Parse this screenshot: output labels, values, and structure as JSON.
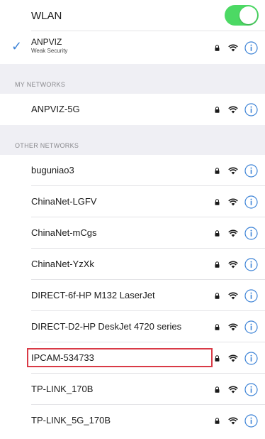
{
  "wlan": {
    "label": "WLAN",
    "toggle_on": true,
    "toggle_color": "#4cd964"
  },
  "current_network": {
    "name": "ANPVIZ",
    "security_note": "Weak Security",
    "connected": true,
    "check_icon": "checkmark-icon"
  },
  "my_networks": {
    "header": "MY NETWORKS",
    "items": [
      {
        "name": "ANPVIZ-5G"
      }
    ]
  },
  "other_networks": {
    "header": "OTHER NETWORKS",
    "items": [
      {
        "name": "buguniao3"
      },
      {
        "name": "ChinaNet-LGFV"
      },
      {
        "name": "ChinaNet-mCgs"
      },
      {
        "name": "ChinaNet-YzXk"
      },
      {
        "name": "DIRECT-6f-HP M132 LaserJet"
      },
      {
        "name": "DIRECT-D2-HP DeskJet 4720 series"
      },
      {
        "name": "IPCAM-534733",
        "highlighted": true
      },
      {
        "name": "TP-LINK_170B"
      },
      {
        "name": "TP-LINK_5G_170B"
      }
    ]
  },
  "colors": {
    "accent": "#3b82d6",
    "section_bg": "#efeff4",
    "highlight": "#d93a46"
  },
  "icons": {
    "lock": "lock-icon",
    "wifi": "wifi-icon",
    "info": "info-icon"
  }
}
